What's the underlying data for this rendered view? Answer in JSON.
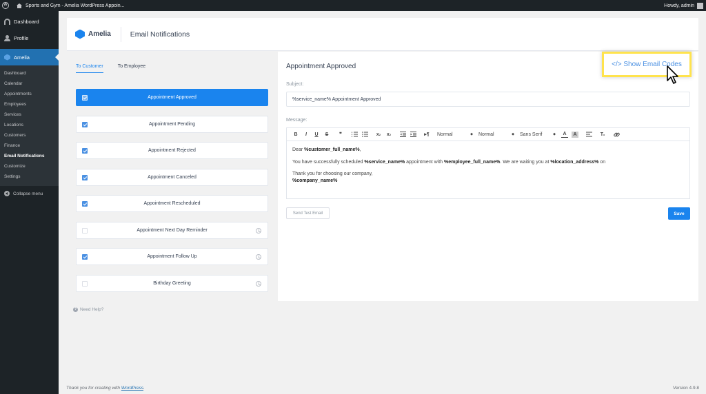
{
  "adminbar": {
    "site_name": "Sports and Gym - Amelia WordPress Appoin...",
    "howdy": "Howdy, admin"
  },
  "sidebar": {
    "top_items": [
      {
        "label": "Dashboard",
        "icon": "dashboard-icon"
      },
      {
        "label": "Profile",
        "icon": "user-icon"
      },
      {
        "label": "Amelia",
        "icon": "amelia-icon"
      }
    ],
    "sub_items": [
      "Dashboard",
      "Calendar",
      "Appointments",
      "Employees",
      "Services",
      "Locations",
      "Customers",
      "Finance",
      "Email Notifications",
      "Customize",
      "Settings"
    ],
    "current_sub": "Email Notifications",
    "collapse_label": "Collapse menu"
  },
  "header": {
    "logo_text": "Amelia",
    "page_title": "Email Notifications"
  },
  "tabs": [
    {
      "label": "To Customer",
      "active": true
    },
    {
      "label": "To Employee",
      "active": false
    }
  ],
  "notifications": [
    {
      "label": "Appointment Approved",
      "checked": true,
      "selected": true,
      "scheduled": false
    },
    {
      "label": "Appointment Pending",
      "checked": true,
      "selected": false,
      "scheduled": false
    },
    {
      "label": "Appointment Rejected",
      "checked": true,
      "selected": false,
      "scheduled": false
    },
    {
      "label": "Appointment Canceled",
      "checked": true,
      "selected": false,
      "scheduled": false
    },
    {
      "label": "Appointment Rescheduled",
      "checked": true,
      "selected": false,
      "scheduled": false
    },
    {
      "label": "Appointment Next Day Reminder",
      "checked": false,
      "selected": false,
      "scheduled": true
    },
    {
      "label": "Appointment Follow Up",
      "checked": true,
      "selected": false,
      "scheduled": true
    },
    {
      "label": "Birthday Greeting",
      "checked": false,
      "selected": false,
      "scheduled": true
    }
  ],
  "help_label": "Need Help?",
  "editor": {
    "title": "Appointment Approved",
    "show_codes_label": "</> Show Email Codes",
    "subject_label": "Subject:",
    "subject_value": "%service_name% Appointment Approved",
    "message_label": "Message:",
    "toolbar": {
      "bold": "B",
      "italic": "I",
      "underline": "U",
      "strike": "S",
      "quote": "❞",
      "size_select": "Normal",
      "header_select": "Normal",
      "font_select": "Sans Serif"
    },
    "body": {
      "greeting_pre": "Dear ",
      "customer_code": "%customer_full_name%",
      "greeting_post": ",",
      "line2_a": "You have successfully scheduled ",
      "service_code": "%service_name%",
      "line2_b": " appointment with ",
      "employee_code": "%employee_full_name%",
      "line2_c": ". We are waiting you at ",
      "location_code": "%location_address%",
      "line2_d": " on",
      "thanks": "Thank you for choosing our company,",
      "company_code": "%company_name%"
    },
    "send_test_label": "Send Test Email",
    "save_label": "Save"
  },
  "footer": {
    "thanks_pre": "Thank you for creating with ",
    "wordpress_link": "WordPress",
    "thanks_post": ".",
    "version": "Version 4.9.8"
  },
  "colors": {
    "accent": "#1a84ee",
    "admin_dark": "#1d2327",
    "highlight": "#ffe34d"
  }
}
